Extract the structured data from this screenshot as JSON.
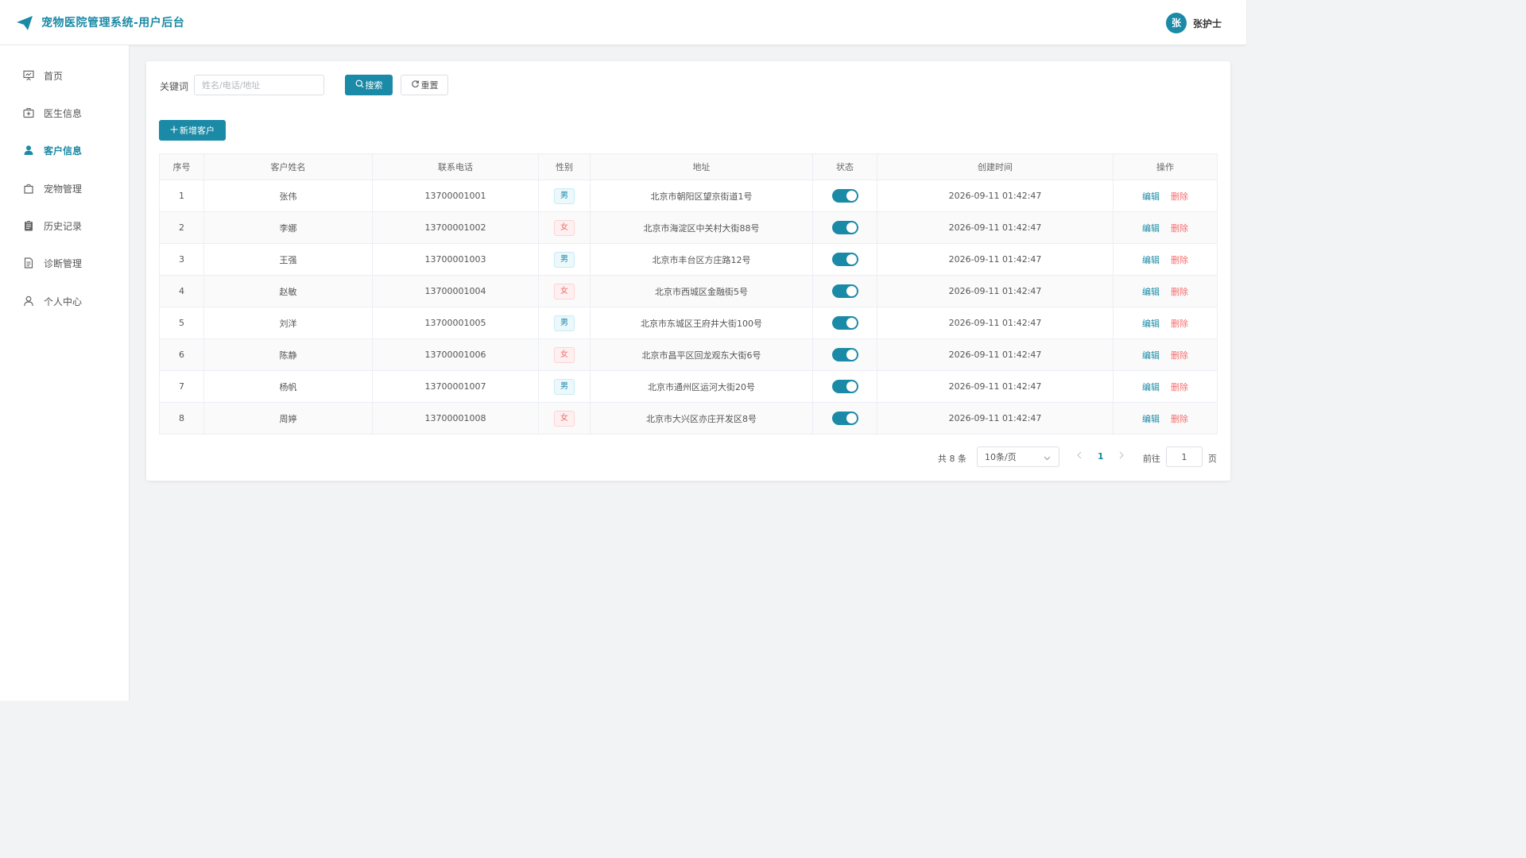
{
  "header": {
    "title": "宠物医院管理系统-用户后台",
    "avatar_char": "张",
    "username": "张护士"
  },
  "sidebar": {
    "items": [
      {
        "label": "首页",
        "icon": "presentation-board-icon",
        "active": false
      },
      {
        "label": "医生信息",
        "icon": "medical-kit-icon",
        "active": false
      },
      {
        "label": "客户信息",
        "icon": "user-filled-icon",
        "active": true
      },
      {
        "label": "宠物管理",
        "icon": "shopping-bag-icon",
        "active": false
      },
      {
        "label": "历史记录",
        "icon": "clipboard-icon",
        "active": false
      },
      {
        "label": "诊断管理",
        "icon": "document-icon",
        "active": false
      },
      {
        "label": "个人中心",
        "icon": "user-outline-icon",
        "active": false
      }
    ]
  },
  "search": {
    "label": "关键词",
    "placeholder": "姓名/电话/地址",
    "value": "",
    "search_btn": "搜索",
    "reset_btn": "重置"
  },
  "add_btn": "新增客户",
  "table": {
    "columns": [
      "序号",
      "客户姓名",
      "联系电话",
      "性别",
      "地址",
      "状态",
      "创建时间",
      "操作"
    ],
    "rows": [
      {
        "no": "1",
        "name": "张伟",
        "phone": "13700001001",
        "gender": "男",
        "address": "北京市朝阳区望京街道1号",
        "status": true,
        "created": "2026-09-11 01:42:47"
      },
      {
        "no": "2",
        "name": "李娜",
        "phone": "13700001002",
        "gender": "女",
        "address": "北京市海淀区中关村大街88号",
        "status": true,
        "created": "2026-09-11 01:42:47"
      },
      {
        "no": "3",
        "name": "王强",
        "phone": "13700001003",
        "gender": "男",
        "address": "北京市丰台区方庄路12号",
        "status": true,
        "created": "2026-09-11 01:42:47"
      },
      {
        "no": "4",
        "name": "赵敏",
        "phone": "13700001004",
        "gender": "女",
        "address": "北京市西城区金融街5号",
        "status": true,
        "created": "2026-09-11 01:42:47"
      },
      {
        "no": "5",
        "name": "刘洋",
        "phone": "13700001005",
        "gender": "男",
        "address": "北京市东城区王府井大街100号",
        "status": true,
        "created": "2026-09-11 01:42:47"
      },
      {
        "no": "6",
        "name": "陈静",
        "phone": "13700001006",
        "gender": "女",
        "address": "北京市昌平区回龙观东大街6号",
        "status": true,
        "created": "2026-09-11 01:42:47"
      },
      {
        "no": "7",
        "name": "杨帆",
        "phone": "13700001007",
        "gender": "男",
        "address": "北京市通州区运河大街20号",
        "status": true,
        "created": "2026-09-11 01:42:47"
      },
      {
        "no": "8",
        "name": "周婷",
        "phone": "13700001008",
        "gender": "女",
        "address": "北京市大兴区亦庄开发区8号",
        "status": true,
        "created": "2026-09-11 01:42:47"
      }
    ],
    "edit_label": "编辑",
    "delete_label": "删除"
  },
  "pagination": {
    "total_text": "共 8 条",
    "page_size": "10条/页",
    "current_page": "1",
    "goto_label": "前往",
    "goto_value": "1",
    "page_suffix": "页"
  },
  "colors": {
    "primary": "#1a8aa6",
    "danger": "#f56c6c"
  }
}
